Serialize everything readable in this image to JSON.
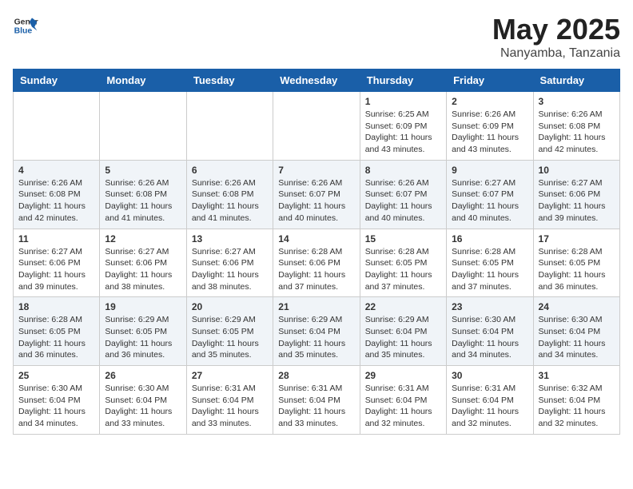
{
  "header": {
    "logo_line1": "General",
    "logo_line2": "Blue",
    "title": "May 2025",
    "subtitle": "Nanyamba, Tanzania"
  },
  "days_of_week": [
    "Sunday",
    "Monday",
    "Tuesday",
    "Wednesday",
    "Thursday",
    "Friday",
    "Saturday"
  ],
  "weeks": [
    [
      {
        "day": "",
        "info": ""
      },
      {
        "day": "",
        "info": ""
      },
      {
        "day": "",
        "info": ""
      },
      {
        "day": "",
        "info": ""
      },
      {
        "day": "1",
        "sunrise": "6:25 AM",
        "sunset": "6:09 PM",
        "daylight": "11 hours and 43 minutes."
      },
      {
        "day": "2",
        "sunrise": "6:26 AM",
        "sunset": "6:09 PM",
        "daylight": "11 hours and 43 minutes."
      },
      {
        "day": "3",
        "sunrise": "6:26 AM",
        "sunset": "6:08 PM",
        "daylight": "11 hours and 42 minutes."
      }
    ],
    [
      {
        "day": "4",
        "sunrise": "6:26 AM",
        "sunset": "6:08 PM",
        "daylight": "11 hours and 42 minutes."
      },
      {
        "day": "5",
        "sunrise": "6:26 AM",
        "sunset": "6:08 PM",
        "daylight": "11 hours and 41 minutes."
      },
      {
        "day": "6",
        "sunrise": "6:26 AM",
        "sunset": "6:08 PM",
        "daylight": "11 hours and 41 minutes."
      },
      {
        "day": "7",
        "sunrise": "6:26 AM",
        "sunset": "6:07 PM",
        "daylight": "11 hours and 40 minutes."
      },
      {
        "day": "8",
        "sunrise": "6:26 AM",
        "sunset": "6:07 PM",
        "daylight": "11 hours and 40 minutes."
      },
      {
        "day": "9",
        "sunrise": "6:27 AM",
        "sunset": "6:07 PM",
        "daylight": "11 hours and 40 minutes."
      },
      {
        "day": "10",
        "sunrise": "6:27 AM",
        "sunset": "6:06 PM",
        "daylight": "11 hours and 39 minutes."
      }
    ],
    [
      {
        "day": "11",
        "sunrise": "6:27 AM",
        "sunset": "6:06 PM",
        "daylight": "11 hours and 39 minutes."
      },
      {
        "day": "12",
        "sunrise": "6:27 AM",
        "sunset": "6:06 PM",
        "daylight": "11 hours and 38 minutes."
      },
      {
        "day": "13",
        "sunrise": "6:27 AM",
        "sunset": "6:06 PM",
        "daylight": "11 hours and 38 minutes."
      },
      {
        "day": "14",
        "sunrise": "6:28 AM",
        "sunset": "6:06 PM",
        "daylight": "11 hours and 37 minutes."
      },
      {
        "day": "15",
        "sunrise": "6:28 AM",
        "sunset": "6:05 PM",
        "daylight": "11 hours and 37 minutes."
      },
      {
        "day": "16",
        "sunrise": "6:28 AM",
        "sunset": "6:05 PM",
        "daylight": "11 hours and 37 minutes."
      },
      {
        "day": "17",
        "sunrise": "6:28 AM",
        "sunset": "6:05 PM",
        "daylight": "11 hours and 36 minutes."
      }
    ],
    [
      {
        "day": "18",
        "sunrise": "6:28 AM",
        "sunset": "6:05 PM",
        "daylight": "11 hours and 36 minutes."
      },
      {
        "day": "19",
        "sunrise": "6:29 AM",
        "sunset": "6:05 PM",
        "daylight": "11 hours and 36 minutes."
      },
      {
        "day": "20",
        "sunrise": "6:29 AM",
        "sunset": "6:05 PM",
        "daylight": "11 hours and 35 minutes."
      },
      {
        "day": "21",
        "sunrise": "6:29 AM",
        "sunset": "6:04 PM",
        "daylight": "11 hours and 35 minutes."
      },
      {
        "day": "22",
        "sunrise": "6:29 AM",
        "sunset": "6:04 PM",
        "daylight": "11 hours and 35 minutes."
      },
      {
        "day": "23",
        "sunrise": "6:30 AM",
        "sunset": "6:04 PM",
        "daylight": "11 hours and 34 minutes."
      },
      {
        "day": "24",
        "sunrise": "6:30 AM",
        "sunset": "6:04 PM",
        "daylight": "11 hours and 34 minutes."
      }
    ],
    [
      {
        "day": "25",
        "sunrise": "6:30 AM",
        "sunset": "6:04 PM",
        "daylight": "11 hours and 34 minutes."
      },
      {
        "day": "26",
        "sunrise": "6:30 AM",
        "sunset": "6:04 PM",
        "daylight": "11 hours and 33 minutes."
      },
      {
        "day": "27",
        "sunrise": "6:31 AM",
        "sunset": "6:04 PM",
        "daylight": "11 hours and 33 minutes."
      },
      {
        "day": "28",
        "sunrise": "6:31 AM",
        "sunset": "6:04 PM",
        "daylight": "11 hours and 33 minutes."
      },
      {
        "day": "29",
        "sunrise": "6:31 AM",
        "sunset": "6:04 PM",
        "daylight": "11 hours and 32 minutes."
      },
      {
        "day": "30",
        "sunrise": "6:31 AM",
        "sunset": "6:04 PM",
        "daylight": "11 hours and 32 minutes."
      },
      {
        "day": "31",
        "sunrise": "6:32 AM",
        "sunset": "6:04 PM",
        "daylight": "11 hours and 32 minutes."
      }
    ]
  ]
}
